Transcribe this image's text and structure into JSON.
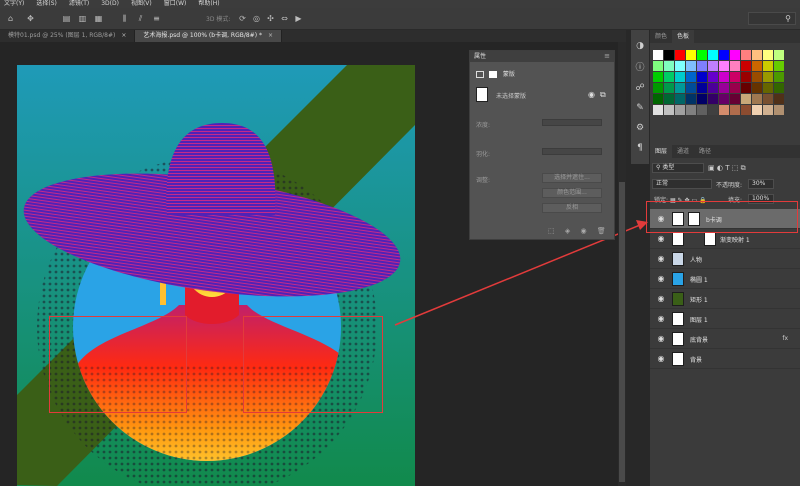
{
  "menu": [
    "文字(Y)",
    "选择(S)",
    "滤镜(T)",
    "3D(D)",
    "视图(V)",
    "窗口(W)",
    "帮助(H)"
  ],
  "options_bar": {
    "mode_label": "3D 模式:",
    "search_value": ""
  },
  "doc_tabs": [
    {
      "label": "模特01.psd @ 25% (图层 1, RGB/8#)",
      "close": "×"
    },
    {
      "label": "艺术海报.psd @ 100% (b卡调, RGB/8#) *",
      "close": "×"
    }
  ],
  "properties": {
    "title": "属性",
    "type_label": "蒙版",
    "mask_name": "未选择蒙版",
    "density_label": "浓度:",
    "feather_label": "羽化:",
    "refine_label": "调整:",
    "btn_select_mask": "选择并遮住...",
    "btn_color_range": "颜色范围...",
    "btn_invert": "反相"
  },
  "dock": {
    "color_tabs": [
      "颜色",
      "色板"
    ],
    "layer_tabs": [
      "图层",
      "通道",
      "路径"
    ],
    "filter_kind": "类型",
    "blend_mode": "正常",
    "opacity_label": "不透明度:",
    "opacity_value": "30%",
    "lock_label": "锁定:",
    "fill_label": "填充:",
    "fill_value": "100%"
  },
  "layers": [
    {
      "name": "b卡调",
      "selected": true,
      "fx": ""
    },
    {
      "name": "渐变映射 1",
      "selected": false,
      "fx": ""
    },
    {
      "name": "人物",
      "selected": false,
      "fx": ""
    },
    {
      "name": "椭圆 1",
      "selected": false,
      "fx": ""
    },
    {
      "name": "矩形 1",
      "selected": false,
      "fx": ""
    },
    {
      "name": "图层 1",
      "selected": false,
      "fx": ""
    },
    {
      "name": "底背景",
      "selected": false,
      "fx": "fx"
    },
    {
      "name": "背景",
      "selected": false,
      "fx": ""
    }
  ],
  "colors": {
    "accent_red": "#e23b3b",
    "hat": "#5a2cc4",
    "stripe_green": "#3a5f17",
    "circle_blue": "#2aa3e6"
  },
  "swatches": [
    "#ffffff",
    "#000000",
    "#ff0000",
    "#ffff00",
    "#00ff00",
    "#00ffff",
    "#0000ff",
    "#ff00ff",
    "#ff7f7f",
    "#ffbf7f",
    "#ffff7f",
    "#bfff7f",
    "#7fff7f",
    "#7fffbf",
    "#7fffff",
    "#7fbfff",
    "#7f7fff",
    "#bf7fff",
    "#ff7fff",
    "#ff7fbf",
    "#cc0000",
    "#cc6600",
    "#cccc00",
    "#66cc00",
    "#00cc00",
    "#00cc66",
    "#00cccc",
    "#0066cc",
    "#0000cc",
    "#6600cc",
    "#cc00cc",
    "#cc0066",
    "#990000",
    "#994c00",
    "#999900",
    "#4c9900",
    "#009900",
    "#00994c",
    "#009999",
    "#004c99",
    "#000099",
    "#4c0099",
    "#990099",
    "#99004c",
    "#660000",
    "#663300",
    "#666600",
    "#336600",
    "#006600",
    "#006633",
    "#006666",
    "#003366",
    "#000066",
    "#330066",
    "#660066",
    "#660033",
    "#c8a878",
    "#a07850",
    "#785030",
    "#503018",
    "#e0e0e0",
    "#c0c0c0",
    "#a0a0a0",
    "#808080",
    "#606060",
    "#404040",
    "#d48c6c",
    "#b06c4c",
    "#8c4c30",
    "#f0d0b0",
    "#d0b090",
    "#b09070"
  ]
}
